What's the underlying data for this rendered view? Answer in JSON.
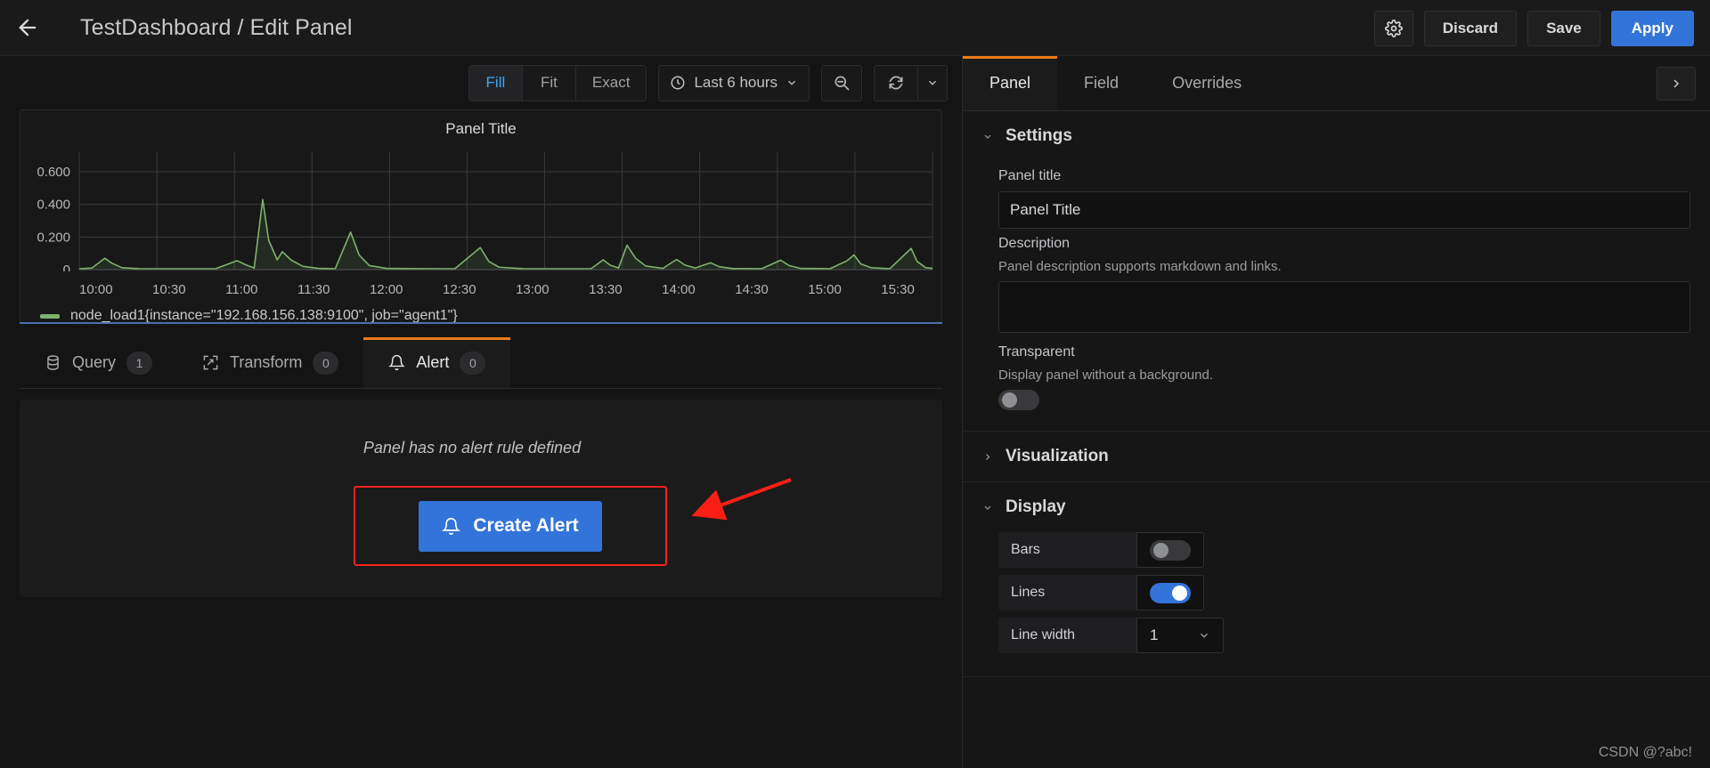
{
  "header": {
    "back_icon": "arrow-left-icon",
    "title": "TestDashboard / Edit Panel",
    "settings_icon": "gear-icon",
    "discard_label": "Discard",
    "save_label": "Save",
    "apply_label": "Apply",
    "accent_primary": "#3274d9"
  },
  "viz_toolbar": {
    "fit_modes": [
      "Fill",
      "Fit",
      "Exact"
    ],
    "active_fit_mode": "Fill",
    "time_range": "Last 6 hours",
    "clock_icon": "clock-icon",
    "zoom_out_icon": "zoom-out-icon",
    "refresh_icon": "refresh-icon",
    "refresh_interval_icon": "chevron-down-icon"
  },
  "panel": {
    "title": "Panel Title",
    "legend_label": "node_load1{instance=\"192.168.156.138:9100\", job=\"agent1\"}",
    "series_color": "#7eb26d"
  },
  "chart_data": {
    "type": "line",
    "title": "Panel Title",
    "xlabel": "",
    "ylabel": "",
    "ylim": [
      0,
      0.72
    ],
    "ytick_labels": [
      "0.600",
      "0.400",
      "0.200",
      "0"
    ],
    "ytick_values": [
      0.6,
      0.4,
      0.2,
      0
    ],
    "xtick_labels": [
      "10:00",
      "10:30",
      "11:00",
      "11:30",
      "12:00",
      "12:30",
      "13:00",
      "13:30",
      "14:00",
      "14:30",
      "15:00",
      "15:30"
    ],
    "grid": true,
    "legend_position": "bottom-left",
    "series": [
      {
        "name": "node_load1{instance=\"192.168.156.138:9100\", job=\"agent1\"}",
        "color": "#7eb26d",
        "fill": true,
        "points": [
          [
            0.0,
            0.005
          ],
          [
            0.015,
            0.01
          ],
          [
            0.03,
            0.07
          ],
          [
            0.038,
            0.04
          ],
          [
            0.05,
            0.012
          ],
          [
            0.07,
            0.006
          ],
          [
            0.12,
            0.005
          ],
          [
            0.16,
            0.006
          ],
          [
            0.185,
            0.055
          ],
          [
            0.195,
            0.03
          ],
          [
            0.205,
            0.01
          ],
          [
            0.215,
            0.43
          ],
          [
            0.222,
            0.18
          ],
          [
            0.232,
            0.06
          ],
          [
            0.238,
            0.11
          ],
          [
            0.248,
            0.06
          ],
          [
            0.262,
            0.02
          ],
          [
            0.28,
            0.008
          ],
          [
            0.3,
            0.006
          ],
          [
            0.318,
            0.23
          ],
          [
            0.328,
            0.09
          ],
          [
            0.34,
            0.025
          ],
          [
            0.36,
            0.008
          ],
          [
            0.4,
            0.006
          ],
          [
            0.44,
            0.005
          ],
          [
            0.47,
            0.135
          ],
          [
            0.48,
            0.05
          ],
          [
            0.492,
            0.015
          ],
          [
            0.52,
            0.006
          ],
          [
            0.56,
            0.005
          ],
          [
            0.6,
            0.006
          ],
          [
            0.614,
            0.06
          ],
          [
            0.622,
            0.028
          ],
          [
            0.632,
            0.01
          ],
          [
            0.642,
            0.15
          ],
          [
            0.652,
            0.07
          ],
          [
            0.664,
            0.022
          ],
          [
            0.684,
            0.008
          ],
          [
            0.7,
            0.062
          ],
          [
            0.71,
            0.028
          ],
          [
            0.722,
            0.01
          ],
          [
            0.74,
            0.042
          ],
          [
            0.75,
            0.018
          ],
          [
            0.765,
            0.007
          ],
          [
            0.8,
            0.006
          ],
          [
            0.822,
            0.058
          ],
          [
            0.832,
            0.025
          ],
          [
            0.845,
            0.008
          ],
          [
            0.88,
            0.006
          ],
          [
            0.9,
            0.055
          ],
          [
            0.908,
            0.09
          ],
          [
            0.916,
            0.035
          ],
          [
            0.928,
            0.012
          ],
          [
            0.95,
            0.006
          ],
          [
            0.975,
            0.13
          ],
          [
            0.982,
            0.05
          ],
          [
            0.992,
            0.012
          ],
          [
            1.0,
            0.008
          ]
        ]
      }
    ]
  },
  "tabs": [
    {
      "label": "Query",
      "badge": "1",
      "icon": "database-icon",
      "active": false
    },
    {
      "label": "Transform",
      "badge": "0",
      "icon": "transform-icon",
      "active": false
    },
    {
      "label": "Alert",
      "badge": "0",
      "icon": "bell-icon",
      "active": true
    }
  ],
  "alert_pane": {
    "empty_message": "Panel has no alert rule defined",
    "create_alert_label": "Create Alert",
    "create_alert_icon": "bell-icon",
    "highlight_color": "#f5231f"
  },
  "options": {
    "tabs": [
      {
        "label": "Panel",
        "active": true
      },
      {
        "label": "Field",
        "active": false
      },
      {
        "label": "Overrides",
        "active": false
      }
    ],
    "expand_icon": "chevron-right-icon",
    "settings": {
      "title": "Settings",
      "expanded": true,
      "panel_title_label": "Panel title",
      "panel_title_value": "Panel Title",
      "description_label": "Description",
      "description_help": "Panel description supports markdown and links.",
      "description_value": "",
      "transparent_label": "Transparent",
      "transparent_help": "Display panel without a background.",
      "transparent_on": false
    },
    "visualization": {
      "title": "Visualization",
      "expanded": false
    },
    "display": {
      "title": "Display",
      "expanded": true,
      "rows": [
        {
          "label": "Bars",
          "type": "toggle",
          "on": false
        },
        {
          "label": "Lines",
          "type": "toggle",
          "on": true
        },
        {
          "label": "Line width",
          "type": "select",
          "value": "1"
        }
      ]
    }
  },
  "watermark": "CSDN @?abc!"
}
